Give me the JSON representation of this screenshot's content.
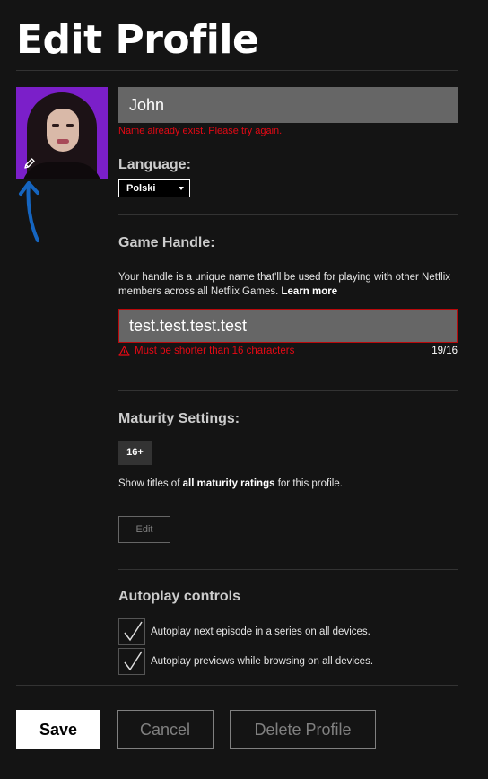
{
  "page": {
    "title": "Edit Profile"
  },
  "profile": {
    "name_value": "John",
    "name_error": "Name already exist. Please try again.",
    "language_label": "Language:",
    "language_value": "Polski"
  },
  "game_handle": {
    "label": "Game Handle:",
    "description": "Your handle is a unique name that'll be used for playing with other Netflix members across all Netflix Games.",
    "learn_more": "Learn more",
    "value": "test.test.test.test",
    "error": "Must be shorter than 16 characters",
    "char_count": "19/16"
  },
  "maturity": {
    "label": "Maturity Settings:",
    "badge": "16+",
    "description_prefix": "Show titles of",
    "description_bold": "all maturity ratings",
    "description_suffix": "for this profile.",
    "edit_label": "Edit"
  },
  "autoplay": {
    "label": "Autoplay controls",
    "options": [
      {
        "label": "Autoplay next episode in a series on all devices.",
        "checked": true
      },
      {
        "label": "Autoplay previews while browsing on all devices.",
        "checked": true
      }
    ]
  },
  "actions": {
    "save": "Save",
    "cancel": "Cancel",
    "delete": "Delete Profile"
  },
  "icons": {
    "avatar_edit": "pencil-icon",
    "error": "warning-triangle-icon",
    "checkbox": "checkmark-icon",
    "dropdown": "caret-down-icon"
  },
  "colors": {
    "background": "#141414",
    "error_red": "#e50914",
    "input_bg": "#666666",
    "annotation_blue": "#1565c0",
    "avatar_bg": "#7b1fc9"
  }
}
